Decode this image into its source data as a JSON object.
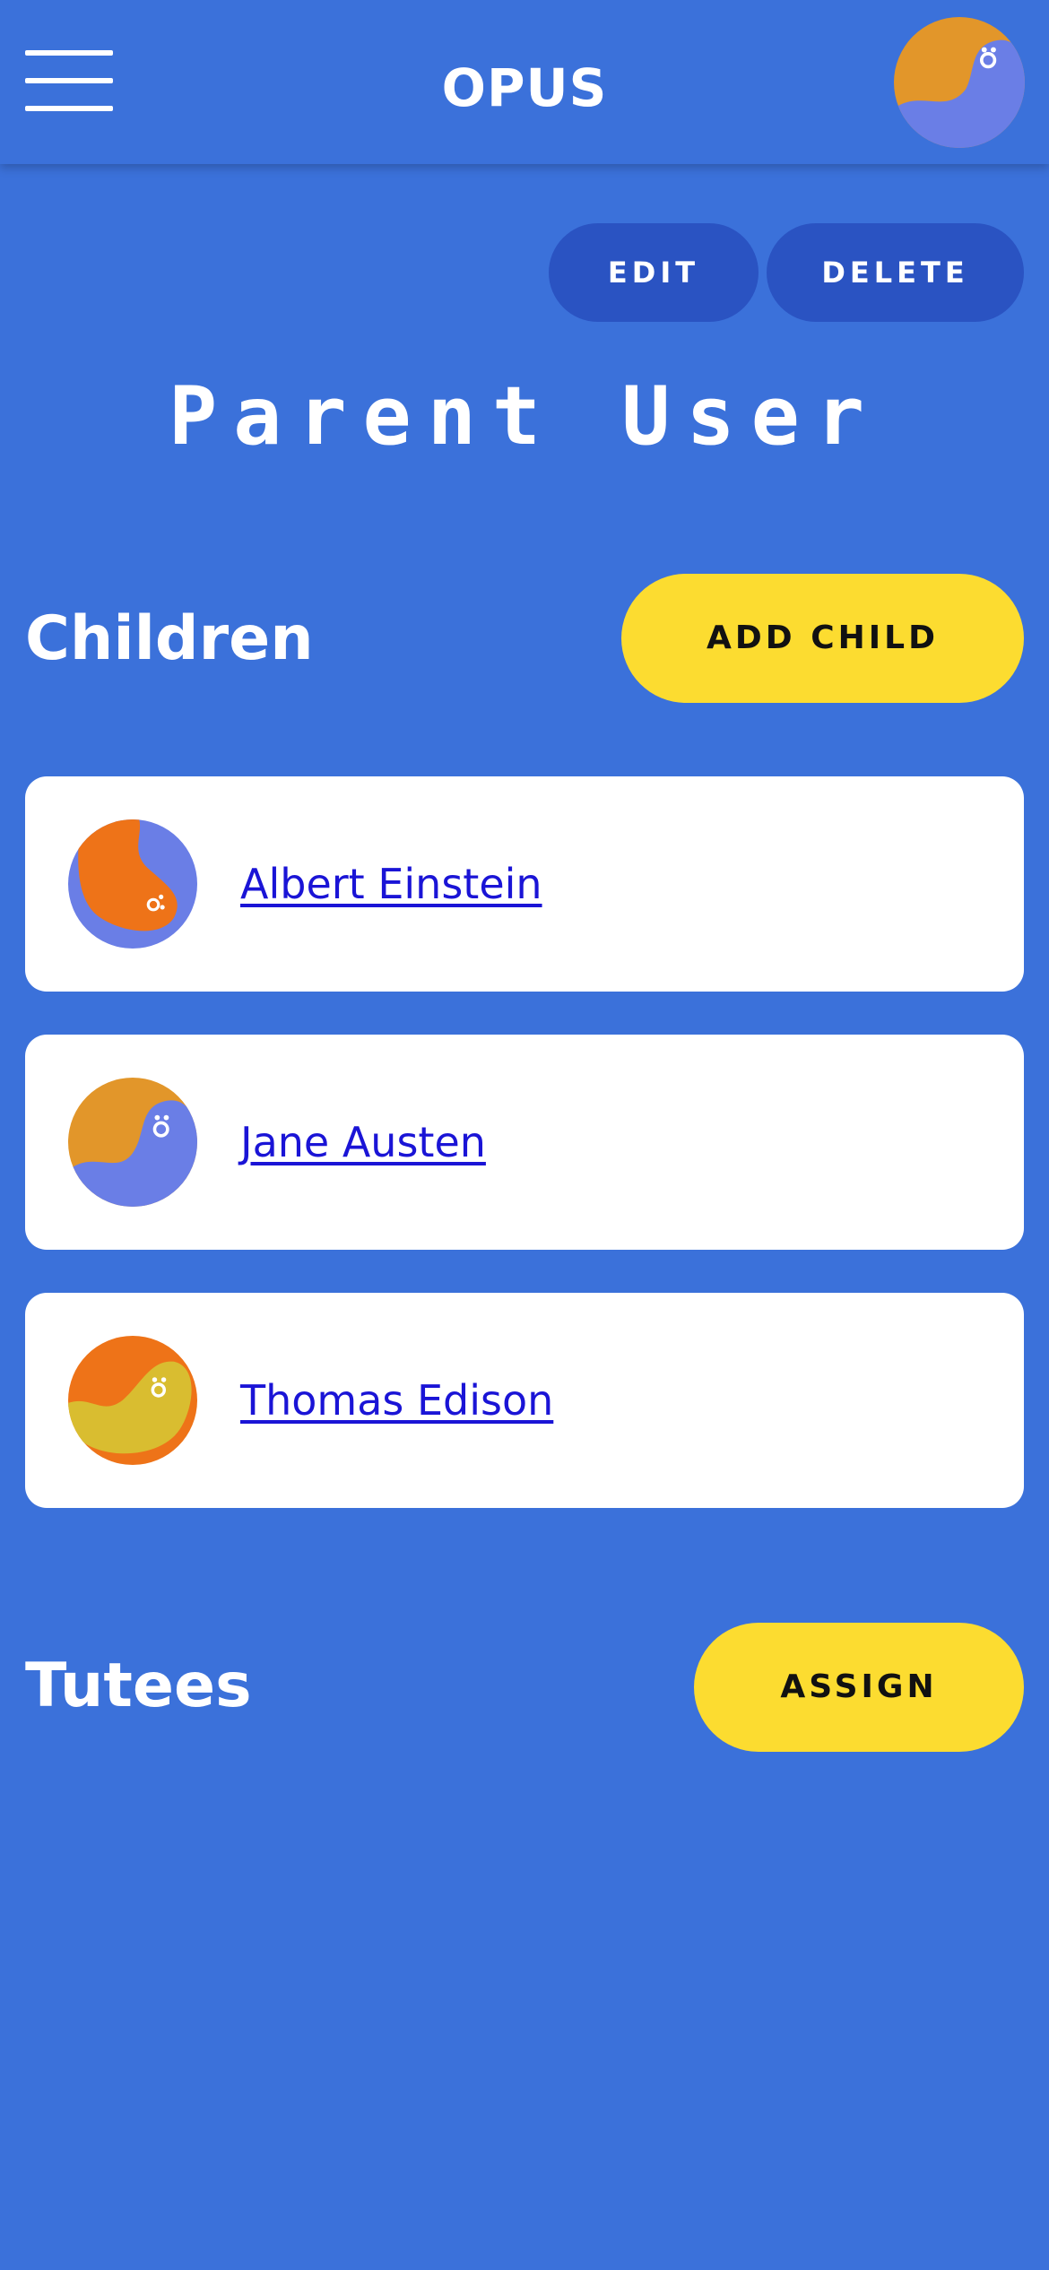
{
  "header": {
    "logo": "OPUS",
    "menu_icon": "hamburger-menu-icon",
    "profile_avatar": "blob-avatar-icon"
  },
  "actions": {
    "edit_label": "EDIT",
    "delete_label": "DELETE"
  },
  "page": {
    "title": "Parent User"
  },
  "children": {
    "heading": "Children",
    "add_label": "ADD CHILD",
    "items": [
      {
        "name": "Albert Einstein",
        "avatar": "blob-avatar-icon",
        "avatar_colors": [
          "#6a7ee6",
          "#ee7318"
        ]
      },
      {
        "name": "Jane Austen",
        "avatar": "blob-avatar-icon",
        "avatar_colors": [
          "#e2962a",
          "#6a7ee6"
        ]
      },
      {
        "name": "Thomas Edison",
        "avatar": "blob-avatar-icon",
        "avatar_colors": [
          "#ee7318",
          "#d9bd30"
        ]
      }
    ]
  },
  "tutees": {
    "heading": "Tutees",
    "assign_label": "ASSIGN"
  },
  "colors": {
    "background": "#3b71da",
    "dark_button": "#2a53c2",
    "accent_button": "#fcdc30",
    "link": "#1a14d6"
  }
}
